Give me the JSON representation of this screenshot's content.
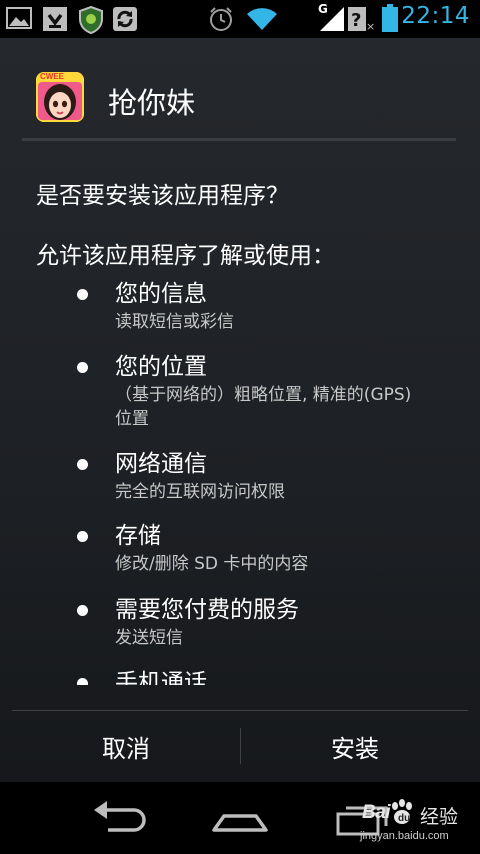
{
  "status_bar": {
    "time": "22:14",
    "network_label": "G",
    "icons": [
      "gallery-icon",
      "download-icon",
      "shield-icon",
      "sync-icon",
      "alarm-icon",
      "wifi-icon",
      "signal-icon",
      "no-sim-icon",
      "battery-icon"
    ],
    "accent_color": "#33b5e5"
  },
  "dialog": {
    "app_name": "抢你妹",
    "app_icon_badge": "CWEE",
    "question": "是否要安装该应用程序？",
    "permissions_intro": "允许该应用程序了解或使用：",
    "permissions": [
      {
        "title": "您的信息",
        "description": "读取短信或彩信"
      },
      {
        "title": "您的位置",
        "description": "（基于网络的）粗略位置, 精准的(GPS)位置"
      },
      {
        "title": "网络通信",
        "description": "完全的互联网访问权限"
      },
      {
        "title": "存储",
        "description": "修改/删除 SD 卡中的内容"
      },
      {
        "title": "需要您付费的服务",
        "description": "发送短信"
      },
      {
        "title": "手机通话",
        "description": ""
      }
    ],
    "buttons": {
      "cancel": "取消",
      "install": "安装"
    }
  },
  "nav_bar": {
    "buttons": [
      "back-icon",
      "home-icon",
      "recents-icon"
    ]
  },
  "watermark": {
    "logo_text": "Bai",
    "brand_text": "经验",
    "url": "jingyan.baidu.com"
  }
}
